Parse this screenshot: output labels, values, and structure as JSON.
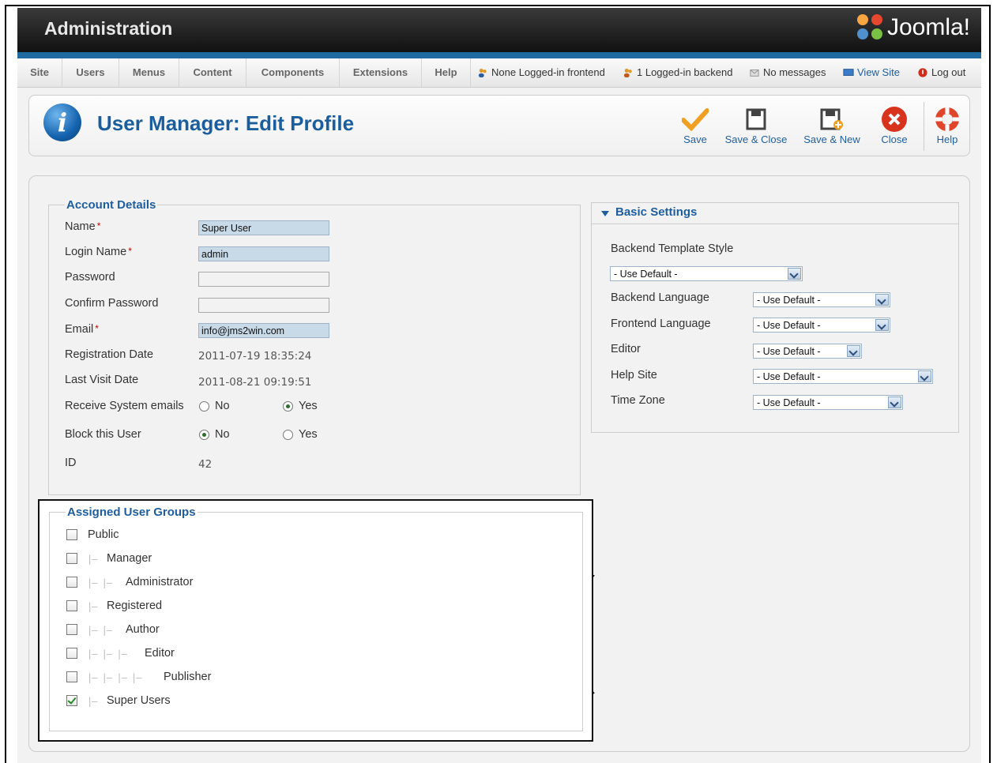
{
  "header": {
    "title": "Administration",
    "logo_text": "Joomla!"
  },
  "menu": {
    "items": [
      "Site",
      "Users",
      "Menus",
      "Content",
      "Components",
      "Extensions",
      "Help"
    ]
  },
  "status": {
    "frontend": "None Logged-in frontend",
    "backend": "1 Logged-in backend",
    "messages": "No messages",
    "view_site": "View Site",
    "logout": "Log out"
  },
  "page": {
    "title": "User Manager: Edit Profile"
  },
  "toolbar": {
    "save": "Save",
    "save_close": "Save & Close",
    "save_new": "Save & New",
    "close": "Close",
    "help": "Help"
  },
  "account": {
    "legend": "Account Details",
    "name_label": "Name",
    "name_value": "Super User",
    "login_label": "Login Name",
    "login_value": "admin",
    "password_label": "Password",
    "confirm_label": "Confirm Password",
    "email_label": "Email",
    "email_value": "info@jms2win.com",
    "reg_label": "Registration Date",
    "reg_value": "2011-07-19 18:35:24",
    "visit_label": "Last Visit Date",
    "visit_value": "2011-08-21 09:19:51",
    "sys_label": "Receive System emails",
    "block_label": "Block this User",
    "no": "No",
    "yes": "Yes",
    "id_label": "ID",
    "id_value": "42",
    "required_mark": "*"
  },
  "basic": {
    "title": "Basic Settings",
    "template_label": "Backend Template Style",
    "template_value": "- Use Default -",
    "backend_lang_label": "Backend Language",
    "backend_lang_value": "- Use Default -",
    "frontend_lang_label": "Frontend Language",
    "frontend_lang_value": "- Use Default -",
    "editor_label": "Editor",
    "editor_value": "- Use Default -",
    "helpsite_label": "Help Site",
    "helpsite_value": "- Use Default -",
    "timezone_label": "Time Zone",
    "timezone_value": "- Use Default -"
  },
  "groups": {
    "legend": "Assigned User Groups",
    "items": [
      {
        "label": "Public",
        "checked": false
      },
      {
        "label": "Manager",
        "checked": false
      },
      {
        "label": "Administrator",
        "checked": false
      },
      {
        "label": "Registered",
        "checked": false
      },
      {
        "label": "Author",
        "checked": false
      },
      {
        "label": "Editor",
        "checked": false
      },
      {
        "label": "Publisher",
        "checked": false
      },
      {
        "label": "Super Users",
        "checked": true
      }
    ]
  },
  "colors": {
    "accent": "#1e5e9f",
    "header_bg": "#1a1a1a",
    "blue_bar": "#1f6aa0",
    "required": "#cc0000"
  }
}
